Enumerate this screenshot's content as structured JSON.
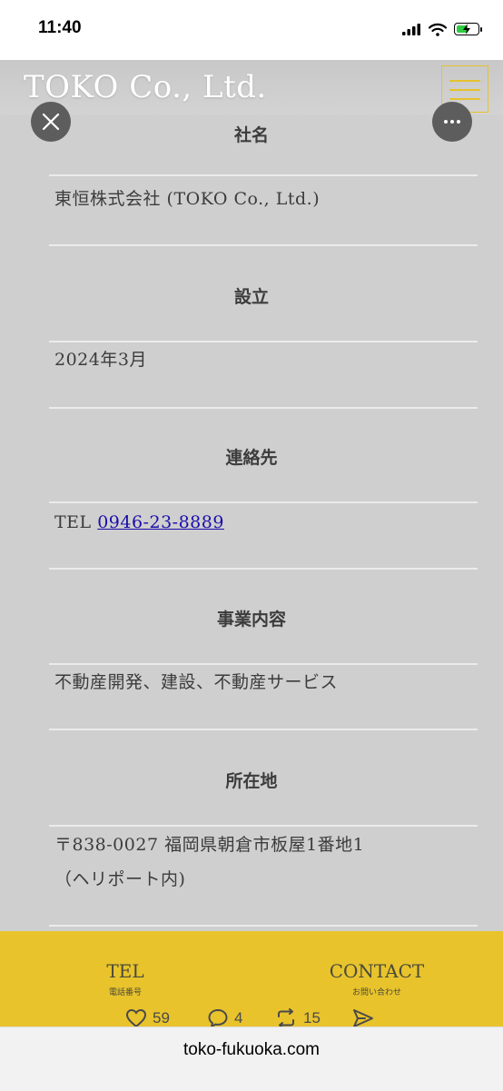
{
  "status_bar": {
    "time": "11:40"
  },
  "header": {
    "logo": "TOKO Co., Ltd."
  },
  "sections": [
    {
      "title": "社名",
      "value": "東恒株式会社 (TOKO Co., Ltd.)"
    },
    {
      "title": "設立",
      "value": "2024年3月"
    },
    {
      "title": "連絡先",
      "value_prefix": "TEL ",
      "phone": "0946-23-8889"
    },
    {
      "title": "事業内容",
      "value": "不動産開発、建設、不動産サービス"
    },
    {
      "title": "所在地",
      "value_line1": "〒838-0027 福岡県朝倉市板屋1番地1",
      "value_line2": "（ヘリポート内)"
    }
  ],
  "bottom_bar": {
    "tel_label": "TEL",
    "tel_sub": "電話番号",
    "contact_label": "CONTACT",
    "contact_sub": "お問い合わせ"
  },
  "social": {
    "likes": "59",
    "comments": "4",
    "reposts": "15"
  },
  "url_bar": {
    "url": "toko-fukuoka.com"
  },
  "colors": {
    "accent_yellow": "#e8c32c",
    "page_gray": "#cfcfcf",
    "link_blue": "#1a0dab"
  }
}
